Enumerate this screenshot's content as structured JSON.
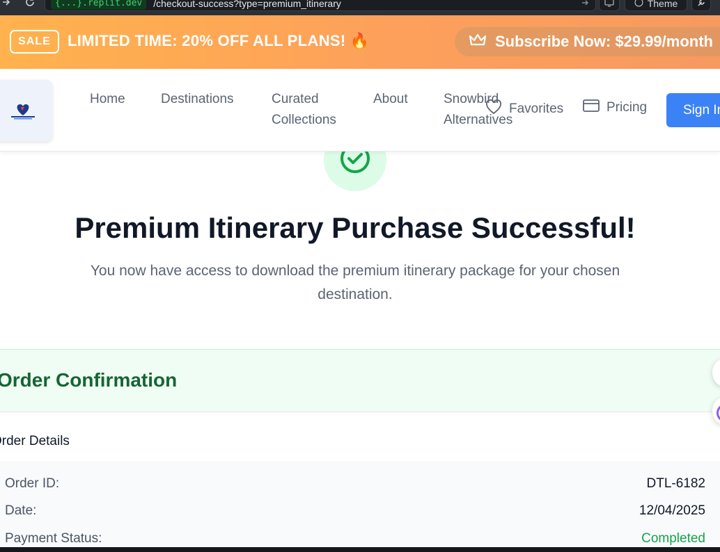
{
  "browser": {
    "url_host": "{...}.replit.dev",
    "url_path": "/checkout-success?type=premium_itinerary",
    "theme_label": "Theme"
  },
  "banner": {
    "badge": "SALE",
    "text": "LIMITED TIME: 20% OFF ALL PLANS! 🔥",
    "subscribe_label": "Subscribe Now: $29.99/month"
  },
  "nav": {
    "links": [
      "Home",
      "Destinations",
      "Curated Collections",
      "About",
      "Snowbird Alternatives"
    ],
    "favorites_label": "Favorites",
    "pricing_label": "Pricing",
    "signin_label": "Sign In"
  },
  "main": {
    "headline": "Premium Itinerary Purchase Successful!",
    "subtext": "You now have access to download the premium itinerary package for your chosen destination.",
    "confirmation_title": "Order Confirmation",
    "details_title": "Order Details",
    "rows": [
      {
        "label": "Order ID:",
        "value": "DTL-6182"
      },
      {
        "label": "Date:",
        "value": "12/04/2025"
      },
      {
        "label": "Payment Status:",
        "value": "Completed"
      }
    ]
  },
  "colors": {
    "accent_blue": "#3b82f6",
    "success_green": "#16a34a",
    "banner_orange": "#fda05b"
  }
}
